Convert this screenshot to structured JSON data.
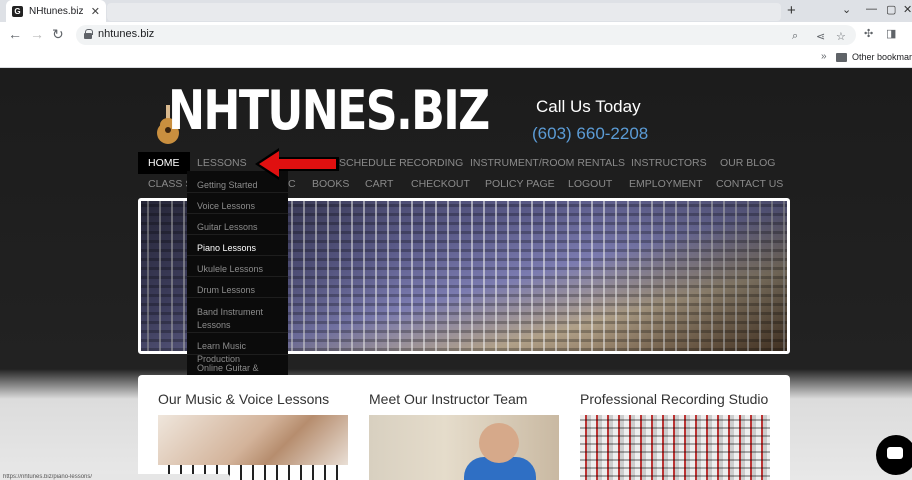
{
  "browser": {
    "tab_title": "NHtunes.biz",
    "favicon_letter": "G",
    "url": "nhtunes.biz",
    "bookmarks": {
      "other_label": "Other bookmarks"
    }
  },
  "header": {
    "logo_text": "NHTUNES.BIZ",
    "call_label": "Call Us Today",
    "phone": "(603) 660-2208"
  },
  "nav": {
    "row1": [
      "HOME",
      "LESSONS",
      "SCHEDULE RECORDING",
      "INSTRUMENT/ROOM RENTALS",
      "INSTRUCTORS",
      "OUR BLOG"
    ],
    "row2": [
      "CLASS S",
      "C",
      "BOOKS",
      "CART",
      "CHECKOUT",
      "POLICY PAGE",
      "LOGOUT",
      "EMPLOYMENT",
      "CONTACT US"
    ]
  },
  "dropdown": {
    "items": [
      "Getting Started",
      "Voice Lessons",
      "Guitar Lessons",
      "Piano Lessons",
      "Ukulele Lessons",
      "Drum Lessons",
      "Band Instrument Lessons",
      "Learn Music Production",
      "Online Guitar & Ukulele Lessons For Adults"
    ],
    "active_item": "Piano Lessons"
  },
  "sections": [
    {
      "title": "Our Music & Voice Lessons"
    },
    {
      "title": "Meet Our Instructor Team"
    },
    {
      "title": "Professional Recording Studio"
    }
  ],
  "status_bar": {
    "text": "https://nhtunes.biz/piano-lessons/"
  },
  "colors": {
    "accent_blue": "#5b9bd5",
    "arrow_red": "#e01010",
    "nav_active_bg": "#000000"
  }
}
